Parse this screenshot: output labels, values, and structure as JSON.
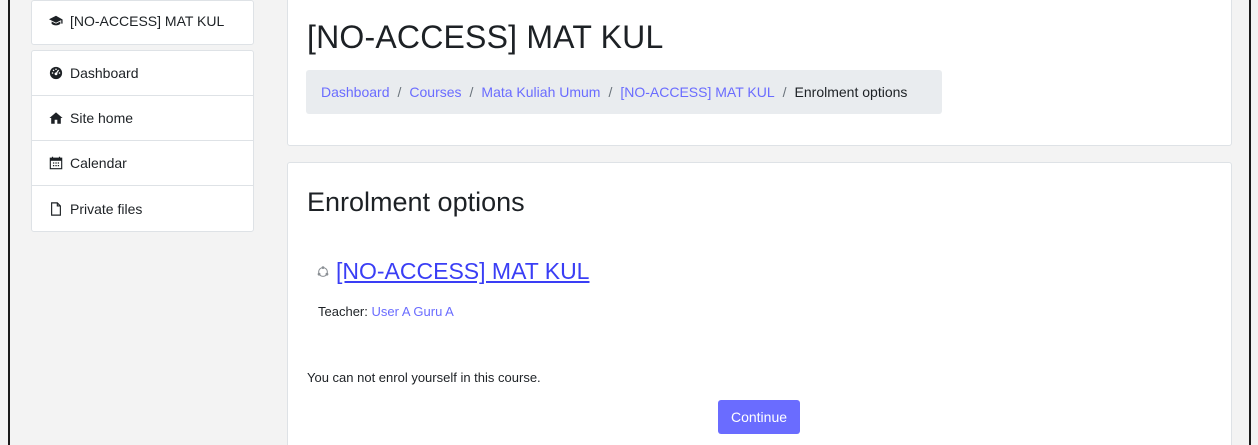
{
  "sidebar": {
    "course_item": {
      "label": "[NO-ACCESS] MAT KUL",
      "icon": "graduation-cap-icon"
    },
    "items": [
      {
        "label": "Dashboard",
        "icon": "tachometer-icon"
      },
      {
        "label": "Site home",
        "icon": "home-icon"
      },
      {
        "label": "Calendar",
        "icon": "calendar-icon"
      },
      {
        "label": "Private files",
        "icon": "file-icon"
      }
    ]
  },
  "header": {
    "title": "[NO-ACCESS] MAT KUL",
    "breadcrumb": [
      {
        "label": "Dashboard"
      },
      {
        "label": "Courses"
      },
      {
        "label": "Mata Kuliah Umum"
      },
      {
        "label": "[NO-ACCESS] MAT KUL"
      },
      {
        "label": "Enrolment options"
      }
    ]
  },
  "main": {
    "section_title": "Enrolment options",
    "course_name": "[NO-ACCESS] MAT KUL",
    "teacher_label": "Teacher:",
    "teacher_name": "User A Guru A",
    "notice": "You can not enrol yourself in this course.",
    "continue_label": "Continue"
  },
  "colors": {
    "link": "#6a6cff",
    "course_link": "#3a3ef5",
    "button": "#6a6cff"
  }
}
